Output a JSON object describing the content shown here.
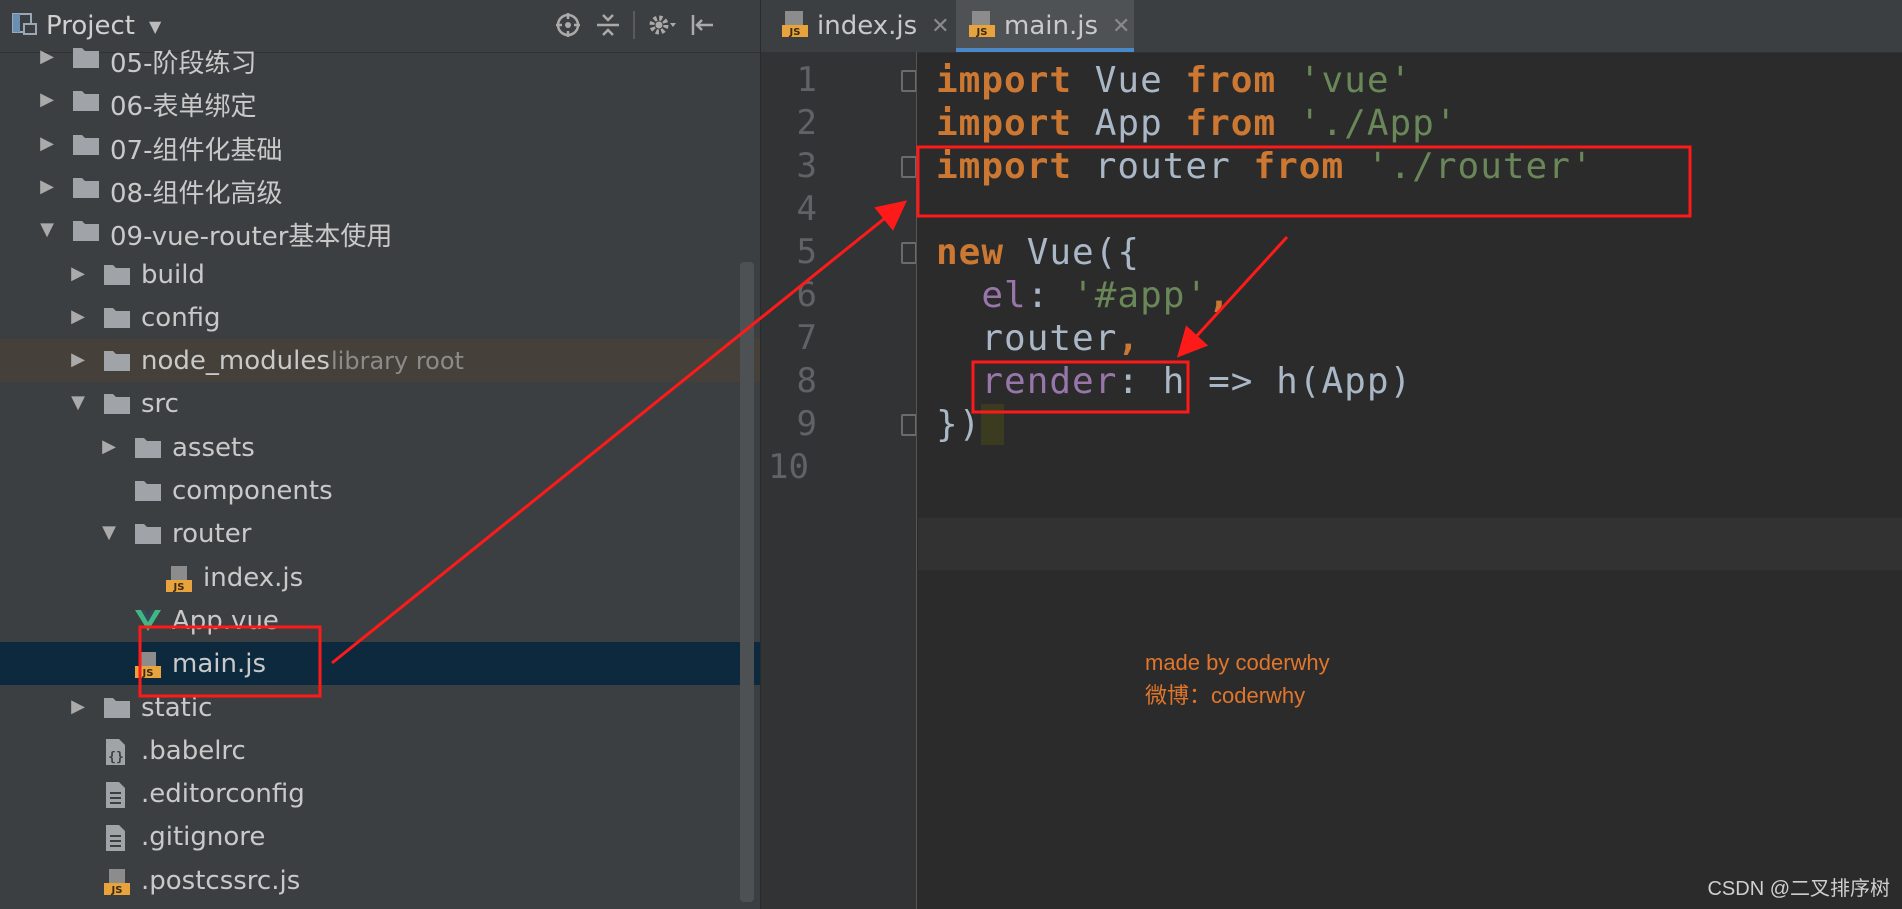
{
  "project_panel": {
    "title": "Project",
    "tree": [
      {
        "label": "05-阶段练习",
        "indent": 0,
        "type": "folder",
        "expanded": false
      },
      {
        "label": "06-表单绑定",
        "indent": 0,
        "type": "folder",
        "expanded": false
      },
      {
        "label": "07-组件化基础",
        "indent": 0,
        "type": "folder",
        "expanded": false
      },
      {
        "label": "08-组件化高级",
        "indent": 0,
        "type": "folder",
        "expanded": false
      },
      {
        "label": "09-vue-router基本使用",
        "indent": 0,
        "type": "folder",
        "expanded": true
      },
      {
        "label": "build",
        "indent": 1,
        "type": "folder",
        "expanded": false
      },
      {
        "label": "config",
        "indent": 1,
        "type": "folder",
        "expanded": false
      },
      {
        "label": "node_modules",
        "hint": "library root",
        "indent": 1,
        "type": "folder",
        "expanded": false
      },
      {
        "label": "src",
        "indent": 1,
        "type": "folder",
        "expanded": true
      },
      {
        "label": "assets",
        "indent": 2,
        "type": "folder",
        "expanded": false
      },
      {
        "label": "components",
        "indent": 2,
        "type": "folder-leaf"
      },
      {
        "label": "router",
        "indent": 2,
        "type": "folder",
        "expanded": true
      },
      {
        "label": "index.js",
        "indent": 3,
        "type": "js"
      },
      {
        "label": "App.vue",
        "indent": 2,
        "type": "vue"
      },
      {
        "label": "main.js",
        "indent": 2,
        "type": "js",
        "selected": true
      },
      {
        "label": "static",
        "indent": 1,
        "type": "folder",
        "expanded": false
      },
      {
        "label": ".babelrc",
        "indent": 1,
        "type": "config"
      },
      {
        "label": ".editorconfig",
        "indent": 1,
        "type": "text"
      },
      {
        "label": ".gitignore",
        "indent": 1,
        "type": "text"
      },
      {
        "label": ".postcssrc.js",
        "indent": 1,
        "type": "js"
      }
    ]
  },
  "editor": {
    "tabs": [
      {
        "label": "index.js",
        "active": false
      },
      {
        "label": "main.js",
        "active": true
      }
    ],
    "line_numbers": [
      "1",
      "2",
      "3",
      "4",
      "5",
      "6",
      "7",
      "8",
      "9",
      "10"
    ],
    "code": [
      [
        {
          "t": "import",
          "c": "kw"
        },
        {
          "t": " Vue ",
          "c": "id"
        },
        {
          "t": "from",
          "c": "kw"
        },
        {
          "t": " ",
          "c": "id"
        },
        {
          "t": "'vue'",
          "c": "str"
        }
      ],
      [
        {
          "t": "import",
          "c": "kw"
        },
        {
          "t": " App ",
          "c": "id"
        },
        {
          "t": "from",
          "c": "kw"
        },
        {
          "t": " ",
          "c": "id"
        },
        {
          "t": "'./App'",
          "c": "str"
        }
      ],
      [
        {
          "t": "import",
          "c": "kw"
        },
        {
          "t": " router ",
          "c": "id"
        },
        {
          "t": "from",
          "c": "kw"
        },
        {
          "t": " ",
          "c": "id"
        },
        {
          "t": "'./router'",
          "c": "str"
        }
      ],
      [],
      [
        {
          "t": "new",
          "c": "kw"
        },
        {
          "t": " Vue({",
          "c": "id"
        }
      ],
      [
        {
          "t": "  ",
          "c": "id"
        },
        {
          "t": "el",
          "c": "prop"
        },
        {
          "t": ": ",
          "c": "id"
        },
        {
          "t": "'#app'",
          "c": "str"
        },
        {
          "t": ",",
          "c": "kw"
        }
      ],
      [
        {
          "t": "  router",
          "c": "id"
        },
        {
          "t": ",",
          "c": "kw"
        }
      ],
      [
        {
          "t": "  ",
          "c": "id"
        },
        {
          "t": "render",
          "c": "prop"
        },
        {
          "t": ": h => h(App)",
          "c": "id"
        }
      ],
      [
        {
          "t": "})",
          "c": "id"
        },
        {
          "t": " ",
          "c": "bracket-hl"
        }
      ],
      []
    ]
  },
  "watermark": {
    "line1": "made by coderwhy",
    "line2": "微博：coderwhy"
  },
  "footer_credit": "CSDN @二叉排序树",
  "colors": {
    "annotation": "#ff1a1a",
    "keyword": "#cc7832",
    "string": "#6a8759",
    "property": "#9876aa",
    "selection": "#0d293e"
  }
}
